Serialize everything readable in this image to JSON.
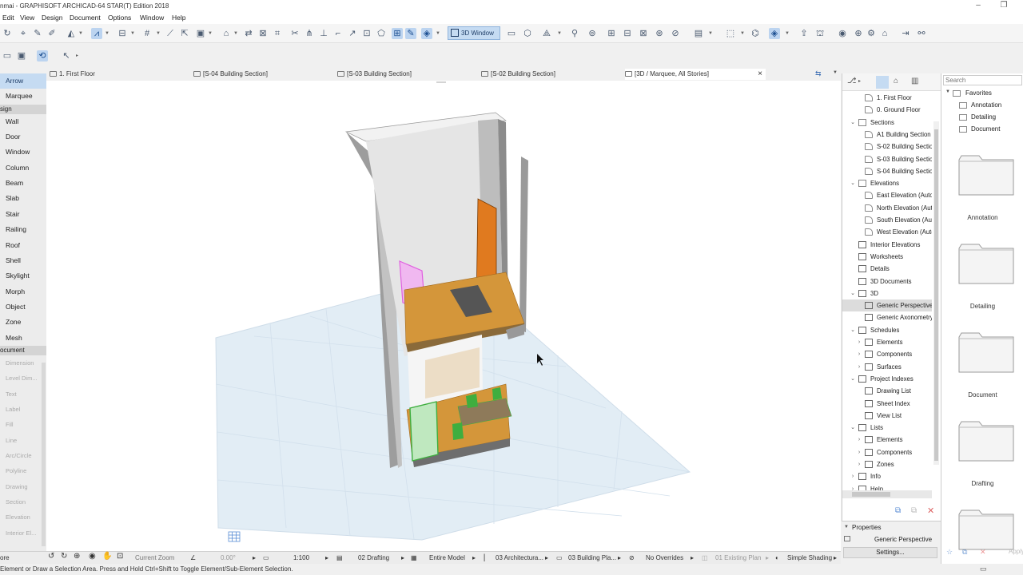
{
  "window": {
    "title": "nmai - GRAPHISOFT ARCHICAD-64 STAR(T) Edition 2018",
    "minimize": "–",
    "restore": "❐"
  },
  "menu": [
    "Edit",
    "View",
    "Design",
    "Document",
    "Options",
    "Window",
    "Help"
  ],
  "toolbar": {
    "btn_3d_window": "3D Window"
  },
  "tabs": [
    {
      "label": "1. First Floor"
    },
    {
      "label": "[S-04 Building Section]"
    },
    {
      "label": "[S-03 Building Section]"
    },
    {
      "label": "[S-02 Building Section]"
    },
    {
      "label": "[3D / Marquee, All Stories]",
      "close": "×"
    }
  ],
  "toolbox": {
    "items": [
      {
        "label": "Arrow",
        "selected": true
      },
      {
        "label": "Marquee"
      },
      {
        "label": "sign",
        "header": true
      },
      {
        "label": "Wall"
      },
      {
        "label": "Door"
      },
      {
        "label": "Window"
      },
      {
        "label": "Column"
      },
      {
        "label": "Beam"
      },
      {
        "label": "Slab"
      },
      {
        "label": "Stair"
      },
      {
        "label": "Railing"
      },
      {
        "label": "Roof"
      },
      {
        "label": "Shell"
      },
      {
        "label": "Skylight"
      },
      {
        "label": "Morph"
      },
      {
        "label": "Object"
      },
      {
        "label": "Zone"
      },
      {
        "label": "Mesh"
      },
      {
        "label": "ocument",
        "header": true
      },
      {
        "label": "Dimension",
        "dim": true
      },
      {
        "label": "Level Dim...",
        "dim": true
      },
      {
        "label": "Text",
        "dim": true
      },
      {
        "label": "Label",
        "dim": true
      },
      {
        "label": "Fill",
        "dim": true
      },
      {
        "label": "Line",
        "dim": true
      },
      {
        "label": "Arc/Circle",
        "dim": true
      },
      {
        "label": "Polyline",
        "dim": true
      },
      {
        "label": "Drawing",
        "dim": true
      },
      {
        "label": "Section",
        "dim": true
      },
      {
        "label": "Elevation",
        "dim": true
      },
      {
        "label": "Interior El...",
        "dim": true
      }
    ]
  },
  "navigator": {
    "items": [
      {
        "label": "1. First Floor",
        "level": 2,
        "icon": "floor"
      },
      {
        "label": "0. Ground Floor",
        "level": 2,
        "icon": "floor"
      },
      {
        "label": "Sections",
        "level": 1,
        "icon": "folder",
        "exp": "v"
      },
      {
        "label": "A1 Building Section",
        "level": 2,
        "icon": "section"
      },
      {
        "label": "S-02 Building Section",
        "level": 2,
        "icon": "section"
      },
      {
        "label": "S-03 Building Section",
        "level": 2,
        "icon": "section"
      },
      {
        "label": "S-04 Building Section",
        "level": 2,
        "icon": "section"
      },
      {
        "label": "Elevations",
        "level": 1,
        "icon": "folder",
        "exp": "v"
      },
      {
        "label": "East Elevation (Auto)",
        "level": 2,
        "icon": "section"
      },
      {
        "label": "North Elevation (Auto)",
        "level": 2,
        "icon": "section"
      },
      {
        "label": "South Elevation (Auto)",
        "level": 2,
        "icon": "section"
      },
      {
        "label": "West Elevation (Auto)",
        "level": 2,
        "icon": "section"
      },
      {
        "label": "Interior Elevations",
        "level": 1,
        "icon": "grid"
      },
      {
        "label": "Worksheets",
        "level": 1,
        "icon": "grid"
      },
      {
        "label": "Details",
        "level": 1,
        "icon": "grid"
      },
      {
        "label": "3D Documents",
        "level": 1,
        "icon": "grid"
      },
      {
        "label": "3D",
        "level": 1,
        "icon": "cube",
        "exp": "v"
      },
      {
        "label": "Generic Perspective",
        "level": 2,
        "icon": "cube",
        "selected": true
      },
      {
        "label": "Generic Axonometry",
        "level": 2,
        "icon": "cube"
      },
      {
        "label": "Schedules",
        "level": 1,
        "icon": "grid",
        "exp": "v"
      },
      {
        "label": "Elements",
        "level": 2,
        "icon": "table",
        "exp": ">"
      },
      {
        "label": "Components",
        "level": 2,
        "icon": "table",
        "exp": ">"
      },
      {
        "label": "Surfaces",
        "level": 2,
        "icon": "table",
        "exp": ">"
      },
      {
        "label": "Project Indexes",
        "level": 1,
        "icon": "grid",
        "exp": "v"
      },
      {
        "label": "Drawing List",
        "level": 2,
        "icon": "table"
      },
      {
        "label": "Sheet Index",
        "level": 2,
        "icon": "table"
      },
      {
        "label": "View List",
        "level": 2,
        "icon": "table"
      },
      {
        "label": "Lists",
        "level": 1,
        "icon": "grid",
        "exp": "v"
      },
      {
        "label": "Elements",
        "level": 2,
        "icon": "table",
        "exp": ">"
      },
      {
        "label": "Components",
        "level": 2,
        "icon": "table",
        "exp": ">"
      },
      {
        "label": "Zones",
        "level": 2,
        "icon": "table",
        "exp": ">"
      },
      {
        "label": "Info",
        "level": 1,
        "icon": "grid",
        "exp": ">"
      },
      {
        "label": "Help",
        "level": 1,
        "icon": "grid",
        "exp": ">"
      }
    ]
  },
  "properties": {
    "header": "Properties",
    "name": "Generic Perspective",
    "settings_button": "Settings..."
  },
  "right_panel": {
    "search_placeholder": "Search",
    "tree": [
      {
        "label": "Favorites",
        "level": 0
      },
      {
        "label": "Annotation",
        "level": 1
      },
      {
        "label": "Detailing",
        "level": 1
      },
      {
        "label": "Document",
        "level": 1
      }
    ],
    "folders": [
      "Annotation",
      "Detailing",
      "Document",
      "Drafting",
      ""
    ],
    "apply": "Apply"
  },
  "statusbar": {
    "current_zoom": "Current Zoom",
    "angle": "0.00°",
    "scale": "1:100",
    "layer_combo": "02 Drafting",
    "model_view": "Entire Model",
    "pen_set": "03 Architectura...",
    "mvo": "03 Building Pla...",
    "overrides": "No Overrides",
    "renovation": "01 Existing Plan",
    "shading": "Simple Shading",
    "left_cut": "ore"
  },
  "hint": "Element or Draw a Selection Area. Press and Hold Ctrl+Shift to Toggle Element/Sub-Element Selection.",
  "colors": {
    "selection": "#c5dbf2",
    "wood": "#d4963a",
    "door": "#e07a1f",
    "green": "#3fae3f",
    "magenta": "#e060e0",
    "ground": "#dce9f2",
    "wall": "#b9b9b9"
  }
}
